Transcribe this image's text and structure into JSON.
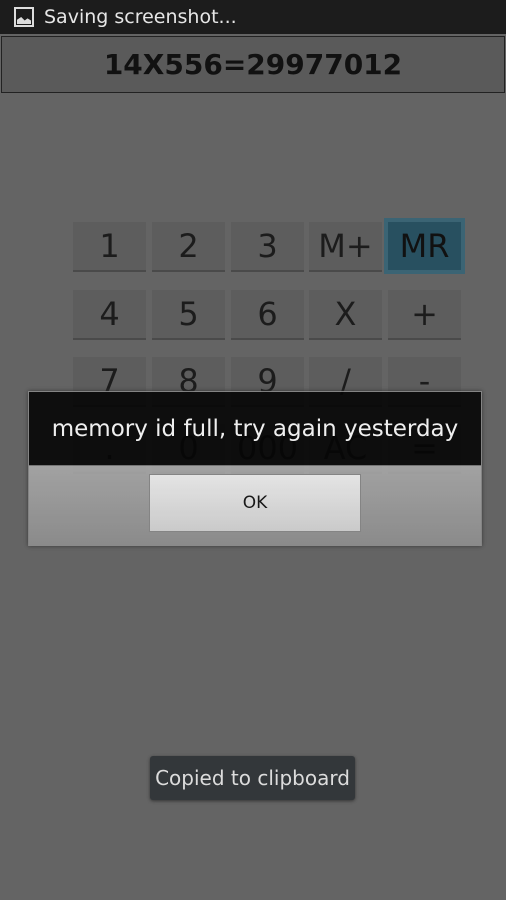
{
  "status_bar": {
    "icon": "image-icon",
    "text": "Saving screenshot..."
  },
  "display": {
    "value": "14X556=29977012"
  },
  "keypad": {
    "rows": [
      [
        "1",
        "2",
        "3",
        "M+",
        "MR"
      ],
      [
        "4",
        "5",
        "6",
        "X",
        "+"
      ],
      [
        "7",
        "8",
        "9",
        "/",
        "-"
      ],
      [
        ".",
        "0",
        "000",
        "AC",
        "="
      ]
    ],
    "highlighted": "MR",
    "highlight_color": "#285060"
  },
  "dialog": {
    "message": "memory id full, try again yesterday",
    "ok_label": "OK"
  },
  "toast": {
    "text": "Copied to clipboard"
  }
}
